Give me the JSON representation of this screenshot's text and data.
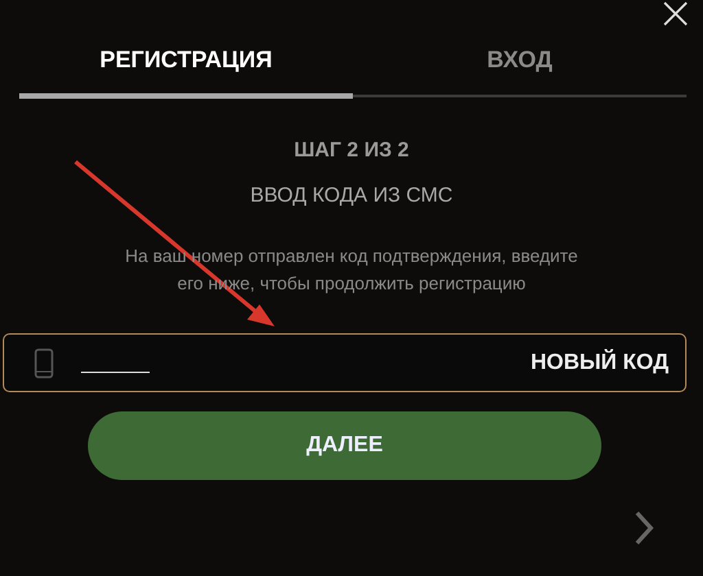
{
  "tabs": [
    {
      "label": "РЕГИСТРАЦИЯ",
      "selected": true
    },
    {
      "label": "ВХОД",
      "selected": false
    }
  ],
  "step": "ШАГ 2 ИЗ 2",
  "subtitle": "ВВОД КОДА ИЗ СМС",
  "description": "На ваш номер отправлен код подтверждения, введите его ниже, чтобы продолжить регистрацию",
  "code_field": {
    "resend_label": "НОВЫЙ КОД"
  },
  "submit_button": "ДАЛЕЕ"
}
